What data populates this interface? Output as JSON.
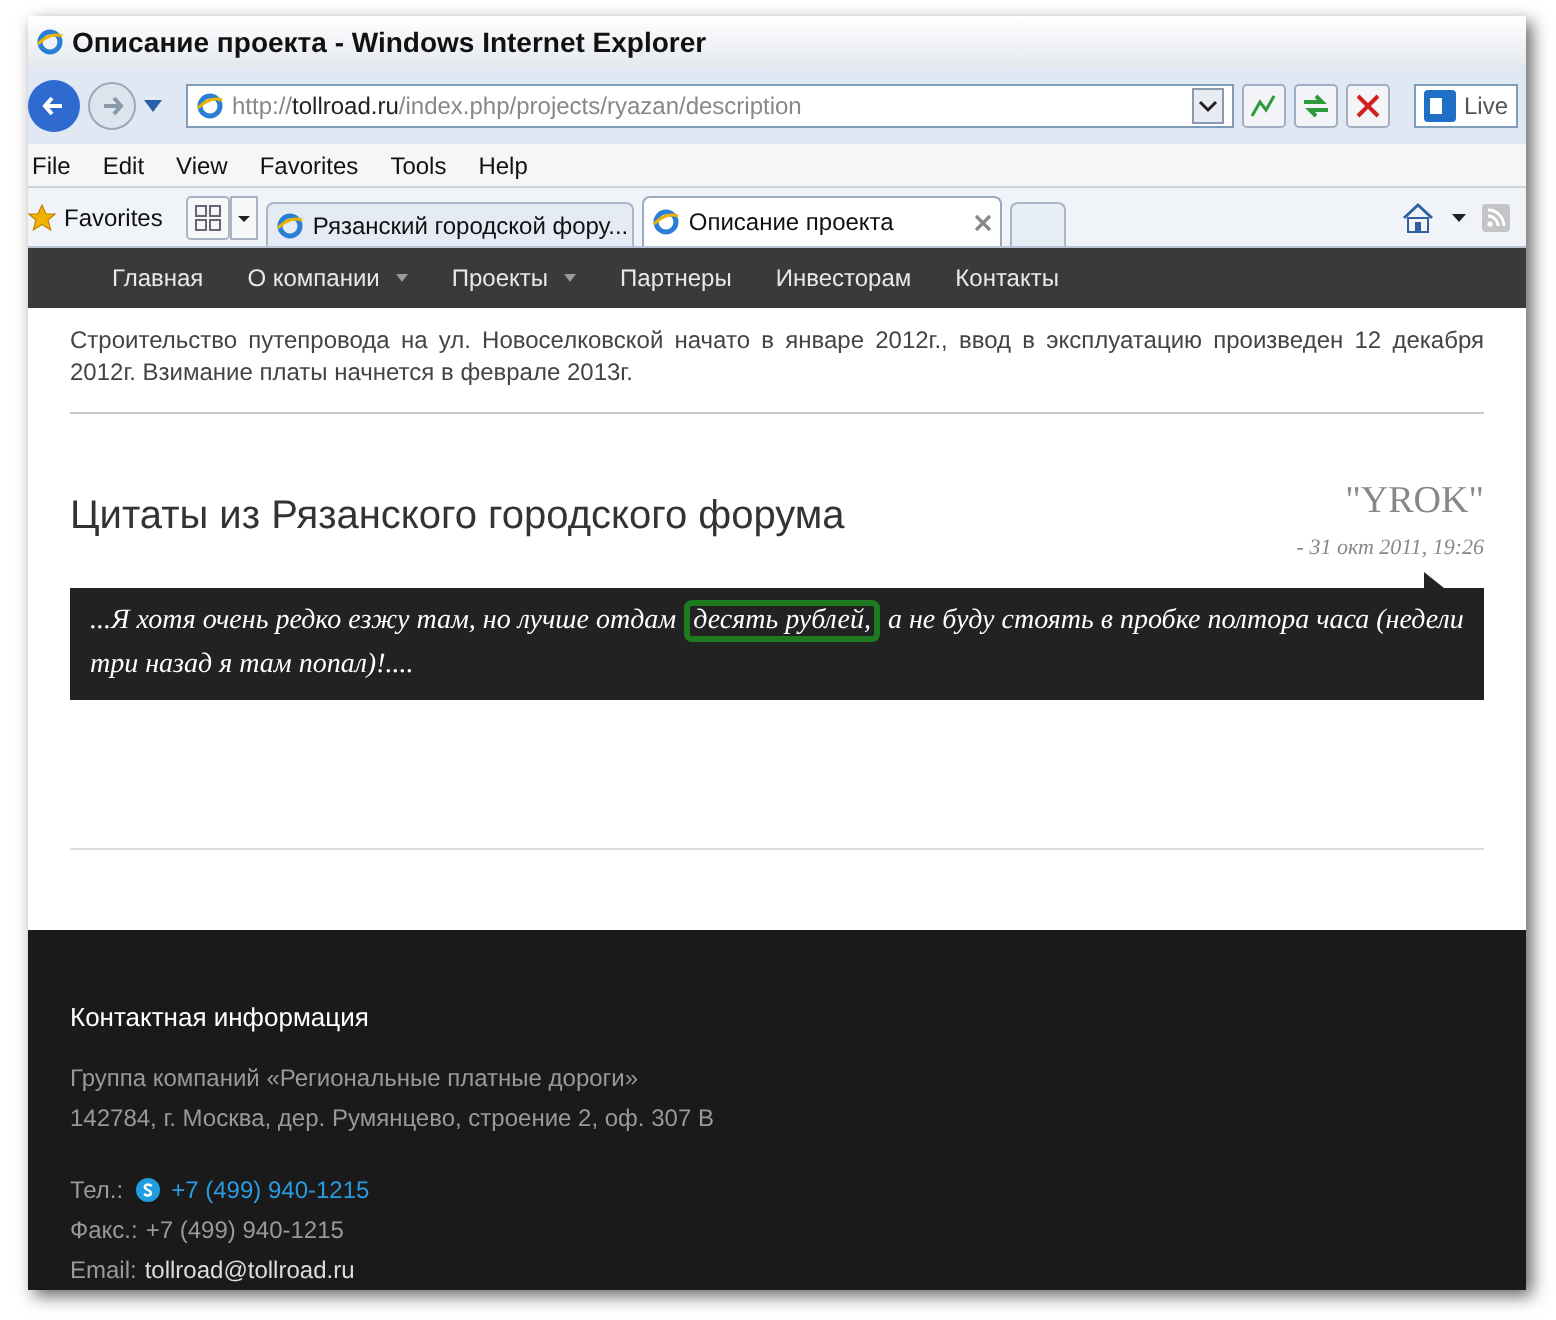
{
  "window": {
    "title": "Описание проекта - Windows Internet Explorer"
  },
  "address_bar": {
    "scheme": "http://",
    "host": "tollroad.ru",
    "path": "/index.php/projects/ryazan/description"
  },
  "toolbar_button": "Live",
  "menu": [
    "File",
    "Edit",
    "View",
    "Favorites",
    "Tools",
    "Help"
  ],
  "favorites_label": "Favorites",
  "tabs": [
    {
      "label": "Рязанский городской фору...",
      "selected": false
    },
    {
      "label": "Описание проекта",
      "selected": true
    }
  ],
  "nav": [
    {
      "label": "Главная",
      "dropdown": false
    },
    {
      "label": "О компании",
      "dropdown": true
    },
    {
      "label": "Проекты",
      "dropdown": true
    },
    {
      "label": "Партнеры",
      "dropdown": false
    },
    {
      "label": "Инвесторам",
      "dropdown": false
    },
    {
      "label": "Контакты",
      "dropdown": false
    }
  ],
  "intro": "Строительство путепровода на ул. Новоселковской начато в январе 2012г., ввод в эксплуатацию произведен 12 декабря 2012г. Взимание платы начнется в феврале 2013г.",
  "section": {
    "title": "Цитаты из Рязанского городского форума",
    "author": "\"YROK\"",
    "date": "- 31 окт 2011, 19:26",
    "quote": {
      "before": "...Я хотя очень редко езжу там, но лучше отдам ",
      "highlight": "десять рублей,",
      "after": " а не буду стоять в пробке полтора часа (недели три назад я там попал)!...."
    }
  },
  "footer": {
    "heading": "Контактная информация",
    "company": "Группа компаний «Региональные платные дороги»",
    "address": "142784, г. Москва, дер. Румянцево, строение 2, оф. 307 В",
    "phone_label": "Тел.:",
    "phone": "+7 (499) 940-1215",
    "fax_label": "Факс.:",
    "fax": "+7 (499) 940-1215",
    "email_label": "Email:",
    "email": "tollroad@tollroad.ru"
  }
}
